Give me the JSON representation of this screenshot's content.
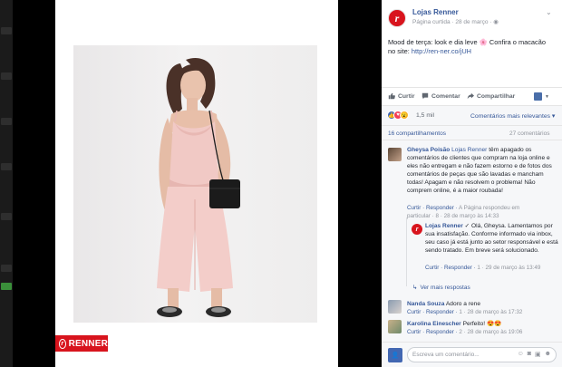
{
  "photo": {
    "brand_label": "RENNER"
  },
  "post": {
    "page_name": "Lojas Renner",
    "meta_label": "Página curtida · 28 de março ·",
    "text": "Mood de terça: look e dia leve 🌸 Confira o macacão no site: ",
    "link": "http://ren-ner.co/jUH"
  },
  "actions": {
    "like": "Curtir",
    "comment": "Comentar",
    "share": "Compartilhar"
  },
  "reactions": {
    "count": "1,5 mil",
    "sort_label": "Comentários mais relevantes ▾"
  },
  "stats": {
    "shares": "16 compartilhamentos",
    "comments": "27 comentários"
  },
  "comments": [
    {
      "author": "Gheysa Poisão",
      "mention": "Lojas Renner",
      "text": " têm apagado os comentários de clientes que compram na loja online e eles não entregam e não fazem estorno e de fotos dos comentários de peças que são lavadas e mancham todas! Apagam e não resolvem o problema! Não comprem online, é a maior roubada!",
      "actions": "Curtir · Responder · ",
      "status": "A Página respondeu em particular · 8 · 28 de março às 14:33"
    },
    {
      "author": "Lojas Renner",
      "text": " ✓ Olá, Gheysa. Lamentamos por sua insatisfação. Conforme informado via inbox, seu caso já está junto ao setor responsável e está sendo tratado. Em breve será solucionado.",
      "actions": "Curtir · Responder · ",
      "status": "1 · 29 de março às 13:49"
    },
    {
      "author": "Nanda Souza",
      "text": " Adoro a rene",
      "actions": "Curtir · Responder · ",
      "status": "1 · 28 de março às 17:32"
    },
    {
      "author": "Karolina Einescher",
      "text": " Perfeito! 😍😍",
      "actions": "Curtir · Responder · ",
      "status": "2 · 28 de março às 19:06"
    }
  ],
  "more_replies": "Ver mais respostas",
  "composer": {
    "placeholder": "Escreva um comentário..."
  }
}
